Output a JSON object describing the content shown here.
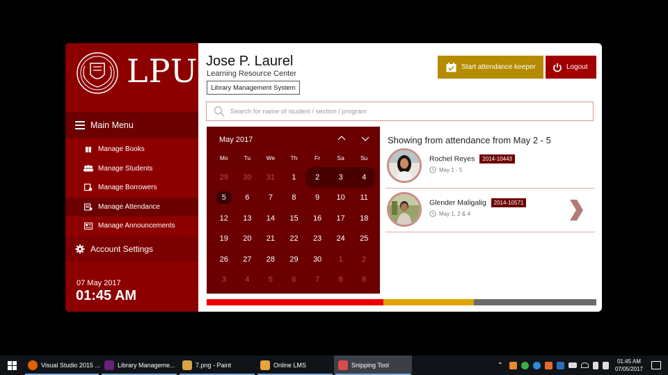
{
  "app": {
    "logo_text": "LPU",
    "user_name": "Jose P. Laurel",
    "user_subtitle": "Learning Resource Center",
    "system_label": "Library Management System",
    "start_attendance_label": "Start attendance keeper",
    "logout_label": "Logout",
    "search_placeholder": "Search for name of student / section / program"
  },
  "sidebar": {
    "main_menu_label": "Main Menu",
    "items": [
      {
        "label": "Manage Books",
        "icon": "book-icon"
      },
      {
        "label": "Manage Students",
        "icon": "students-icon"
      },
      {
        "label": "Manage Borrowers",
        "icon": "borrowers-icon"
      },
      {
        "label": "Manage Attendance",
        "icon": "attendance-icon",
        "active": true
      },
      {
        "label": "Manage Announcements",
        "icon": "announcements-icon"
      }
    ],
    "account_settings_label": "Account Settings",
    "date": "07 May 2017",
    "time": "01:45 AM"
  },
  "calendar": {
    "month_label": "May 2017",
    "weekdays": [
      "Mo",
      "Tu",
      "We",
      "Th",
      "Fr",
      "Sa",
      "Su"
    ],
    "days": [
      {
        "d": "29",
        "other": true
      },
      {
        "d": "30",
        "other": true
      },
      {
        "d": "31",
        "other": true
      },
      {
        "d": "1"
      },
      {
        "d": "2",
        "range": "start"
      },
      {
        "d": "3",
        "range": "mid"
      },
      {
        "d": "4",
        "range": "end"
      },
      {
        "d": "5",
        "today": true
      },
      {
        "d": "6"
      },
      {
        "d": "7"
      },
      {
        "d": "8"
      },
      {
        "d": "9"
      },
      {
        "d": "10"
      },
      {
        "d": "11"
      },
      {
        "d": "12"
      },
      {
        "d": "13"
      },
      {
        "d": "14"
      },
      {
        "d": "15"
      },
      {
        "d": "16"
      },
      {
        "d": "17"
      },
      {
        "d": "18"
      },
      {
        "d": "19"
      },
      {
        "d": "20"
      },
      {
        "d": "21"
      },
      {
        "d": "22"
      },
      {
        "d": "23"
      },
      {
        "d": "24"
      },
      {
        "d": "25"
      },
      {
        "d": "26"
      },
      {
        "d": "27"
      },
      {
        "d": "28"
      },
      {
        "d": "29"
      },
      {
        "d": "30"
      },
      {
        "d": "1",
        "other": true
      },
      {
        "d": "2",
        "other": true
      },
      {
        "d": "3",
        "other": true
      },
      {
        "d": "4",
        "other": true
      },
      {
        "d": "5",
        "other": true
      },
      {
        "d": "6",
        "other": true
      },
      {
        "d": "7",
        "other": true
      },
      {
        "d": "8",
        "other": true
      },
      {
        "d": "9",
        "other": true
      }
    ]
  },
  "attendance": {
    "title": "Showing from attendance from May 2 - 5",
    "entries": [
      {
        "name": "Rochel Reyes",
        "id": "2014-10443",
        "dates": "May 1 - 5"
      },
      {
        "name": "Glender Maligalig",
        "id": "2014-10571",
        "dates": "May 1, 2 & 4"
      }
    ]
  },
  "colors": {
    "sidebar": "#8d0000",
    "calendar": "#6a0000",
    "attendance_button": "#b58b00",
    "logout_button": "#a10000",
    "strip": [
      "#ee0000",
      "#e0a300",
      "#6b6b6b"
    ]
  },
  "taskbar": {
    "items": [
      {
        "label": "Visual Studio 2015 ...",
        "icon": "firefox-icon",
        "color": "#e66000"
      },
      {
        "label": "Library Manageme...",
        "icon": "visual-studio-icon",
        "color": "#68217a"
      },
      {
        "label": "7.png - Paint",
        "icon": "paint-icon",
        "color": "#d9a441"
      },
      {
        "label": "Online LMS",
        "icon": "winforms-icon",
        "color": "#e8a33b"
      },
      {
        "label": "Snipping Tool",
        "icon": "snipping-tool-icon",
        "color": "#d94b4b"
      }
    ],
    "clock_time": "01:45 AM",
    "clock_date": "07/05/2017"
  }
}
